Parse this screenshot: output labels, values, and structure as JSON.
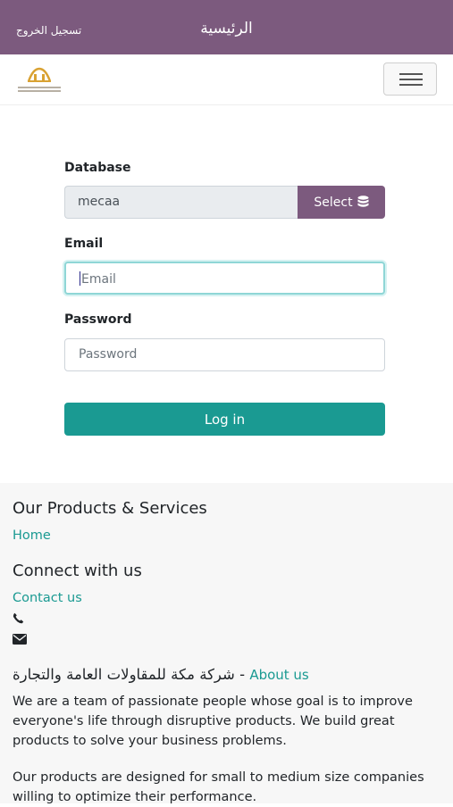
{
  "topbar": {
    "title": "الرئيسية",
    "logout": "تسجيل الخروج"
  },
  "navbar": {
    "logo_icon": "company-logo",
    "menu_icon": "hamburger-icon"
  },
  "form": {
    "database_label": "Database",
    "database_value": "mecaa",
    "select_label": "Select",
    "select_icon": "database-icon",
    "email_label": "Email",
    "email_placeholder": "Email",
    "password_label": "Password",
    "password_placeholder": "Password",
    "login_label": "Log in"
  },
  "footer": {
    "products_heading": "Our Products & Services",
    "home_link": "Home",
    "connect_heading": "Connect with us",
    "contact_link": "Contact us",
    "phone_icon": "phone-icon",
    "email_icon": "envelope-icon",
    "company_name": "شركة مكة للمقاولات العامة والتجارة",
    "separator": " - ",
    "about_link": "About us",
    "about_text_1": "We are a team of passionate people whose goal is to improve everyone's life through disruptive products. We build great products to solve your business problems.",
    "about_text_2": "Our products are designed for small to medium size companies willing to optimize their performance."
  },
  "colors": {
    "brand": "#7c5a7e",
    "primary": "#1a9a92",
    "link": "#1a9a92"
  }
}
